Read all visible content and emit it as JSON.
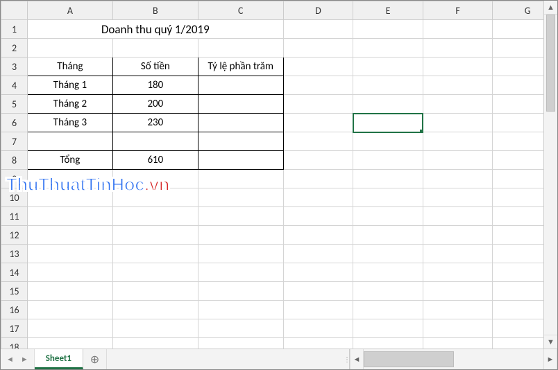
{
  "columns": [
    "A",
    "B",
    "C",
    "D",
    "E",
    "F",
    "G"
  ],
  "row_count": 18,
  "selected_cell": "E6",
  "title": {
    "text": "Doanh thu quý 1/2019",
    "merge": "A1:C1"
  },
  "table": {
    "header_row": 3,
    "headers": {
      "A": "Tháng",
      "B": "Số tiền",
      "C": "Tỷ lệ phần trăm"
    },
    "rows": [
      {
        "r": 4,
        "A": "Tháng 1",
        "B": "180",
        "C": ""
      },
      {
        "r": 5,
        "A": "Tháng 2",
        "B": "200",
        "C": ""
      },
      {
        "r": 6,
        "A": "Tháng 3",
        "B": "230",
        "C": ""
      },
      {
        "r": 7,
        "A": "",
        "B": "",
        "C": ""
      }
    ],
    "footer": {
      "r": 8,
      "A": "Tổng",
      "B": "610",
      "C": ""
    }
  },
  "tabs": {
    "active": "Sheet1"
  },
  "watermark": {
    "main": "ThuThuatTinHoc",
    "suffix": ".vn"
  }
}
